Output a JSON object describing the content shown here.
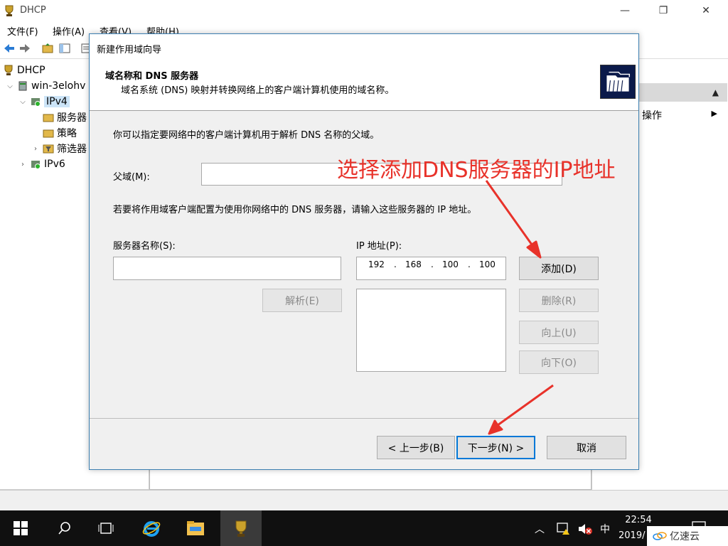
{
  "window": {
    "title": "DHCP",
    "minimize": "—",
    "maximize": "❐",
    "close": "✕"
  },
  "menu": {
    "file": "文件(F)",
    "action": "操作(A)",
    "view": "查看(V)",
    "help": "帮助(H)"
  },
  "tree": {
    "root": "DHCP",
    "server": "win-3elohv",
    "ipv4": "IPv4",
    "servers": "服务器",
    "policies": "策略",
    "filters": "筛选器",
    "ipv6": "IPv6"
  },
  "actions": {
    "more_actions": "操作"
  },
  "wizard": {
    "title": "新建作用域向导",
    "heading": "域名称和 DNS 服务器",
    "subheading": "域名系统 (DNS) 映射并转换网络上的客户端计算机使用的域名称。",
    "intro": "你可以指定要网络中的客户端计算机用于解析 DNS 名称的父域。",
    "parent_domain_label": "父域(M):",
    "parent_domain_value": "",
    "dns_intro": "若要将作用域客户端配置为使用你网络中的 DNS 服务器，请输入这些服务器的 IP 地址。",
    "server_name_label": "服务器名称(S):",
    "server_name_value": "",
    "ip_label": "IP 地址(P):",
    "ip": {
      "o1": "192",
      "o2": "168",
      "o3": "100",
      "o4": "100",
      "dot": "."
    },
    "resolve": "解析(E)",
    "add": "添加(D)",
    "remove": "删除(R)",
    "up": "向上(U)",
    "down": "向下(O)",
    "back": "< 上一步(B)",
    "next": "下一步(N) >",
    "cancel": "取消"
  },
  "annotation": {
    "text": "选择添加DNS服务器的IP地址",
    "color": "#e8322a"
  },
  "taskbar": {
    "time": "22:54",
    "date": "2019/",
    "ime": "中"
  },
  "watermark": {
    "text": "亿速云"
  }
}
